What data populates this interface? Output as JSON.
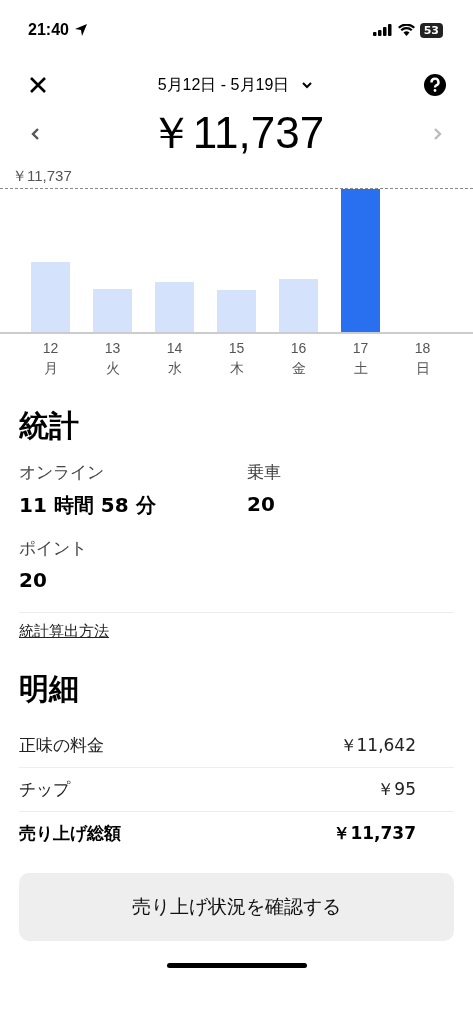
{
  "status_bar": {
    "time": "21:40",
    "battery": "53"
  },
  "header": {
    "date_range": "5月12日 - 5月19日",
    "total": "￥11,737"
  },
  "chart": {
    "max_label": "￥11,737",
    "days": [
      {
        "day": "12",
        "weekday": "月",
        "selected": false
      },
      {
        "day": "13",
        "weekday": "火",
        "selected": false
      },
      {
        "day": "14",
        "weekday": "水",
        "selected": false
      },
      {
        "day": "15",
        "weekday": "木",
        "selected": false
      },
      {
        "day": "16",
        "weekday": "金",
        "selected": false
      },
      {
        "day": "17",
        "weekday": "土",
        "selected": true
      },
      {
        "day": "18",
        "weekday": "日",
        "selected": false
      }
    ]
  },
  "stats": {
    "title": "統計",
    "items": [
      {
        "label": "オンライン",
        "value": "11 時間 58 分"
      },
      {
        "label": "乗車",
        "value": "20"
      },
      {
        "label": "ポイント",
        "value": "20"
      }
    ],
    "link": "統計算出方法"
  },
  "details": {
    "title": "明細",
    "rows": [
      {
        "label": "正味の料金",
        "amount": "￥11,642",
        "bold": false
      },
      {
        "label": "チップ",
        "amount": "￥95",
        "bold": false
      },
      {
        "label": "売り上げ総額",
        "amount": "￥11,737",
        "bold": true
      }
    ]
  },
  "button": "売り上げ状況を確認する"
}
